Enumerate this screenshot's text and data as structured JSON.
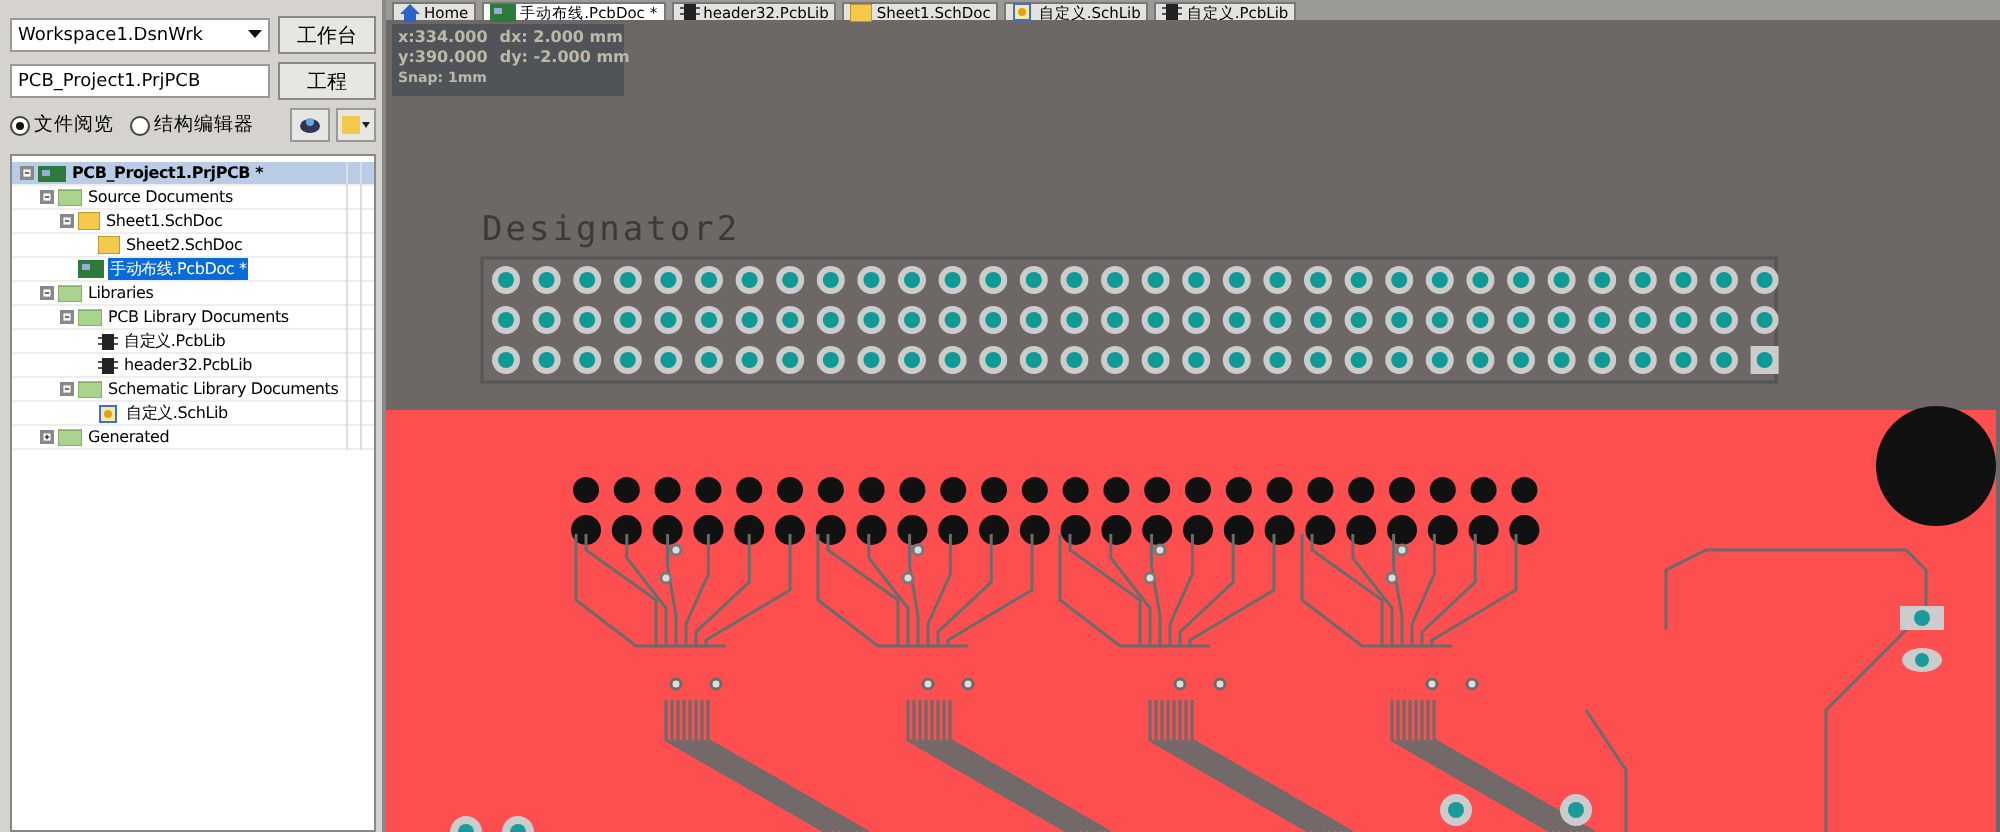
{
  "workspace": {
    "combo_value": "Workspace1.DsnWrk",
    "button": "工作台"
  },
  "project": {
    "field_value": "PCB_Project1.PrjPCB",
    "button": "工程"
  },
  "view_modes": [
    {
      "label": "文件阅览",
      "selected": true
    },
    {
      "label": "结构编辑器",
      "selected": false
    }
  ],
  "tree": [
    {
      "label": "PCB_Project1.PrjPCB *",
      "kind": "project",
      "expanded": true,
      "selected": false,
      "children": [
        {
          "label": "Source Documents",
          "kind": "folder",
          "expanded": true,
          "selected": false,
          "children": [
            {
              "label": "Sheet1.SchDoc",
              "kind": "schdoc",
              "expanded": true,
              "selected": false,
              "children": [
                {
                  "label": "Sheet2.SchDoc",
                  "kind": "schdoc",
                  "selected": false
                }
              ]
            },
            {
              "label": "手动布线.PcbDoc *",
              "kind": "pcbdoc",
              "selected": true
            }
          ]
        },
        {
          "label": "Libraries",
          "kind": "folder",
          "expanded": true,
          "selected": false,
          "children": [
            {
              "label": "PCB Library Documents",
              "kind": "folder",
              "expanded": true,
              "selected": false,
              "children": [
                {
                  "label": "自定义.PcbLib",
                  "kind": "pcblib",
                  "selected": false
                },
                {
                  "label": "header32.PcbLib",
                  "kind": "pcblib",
                  "selected": false
                }
              ]
            },
            {
              "label": "Schematic Library Documents",
              "kind": "folder",
              "expanded": true,
              "selected": false,
              "children": [
                {
                  "label": "自定义.SchLib",
                  "kind": "schlib",
                  "selected": false
                }
              ]
            }
          ]
        },
        {
          "label": "Generated",
          "kind": "folder",
          "expanded": false,
          "selected": false
        }
      ]
    }
  ],
  "doc_tabs": [
    {
      "label": "Home",
      "kind": "home",
      "selected": false
    },
    {
      "label": "手动布线.PcbDoc *",
      "kind": "pcbdoc",
      "selected": true
    },
    {
      "label": "header32.PcbLib",
      "kind": "pcblib",
      "selected": false
    },
    {
      "label": "Sheet1.SchDoc",
      "kind": "schdoc",
      "selected": false
    },
    {
      "label": "自定义.SchLib",
      "kind": "schlib",
      "selected": false
    },
    {
      "label": "自定义.PcbLib",
      "kind": "pcblib",
      "selected": false
    }
  ],
  "coords": {
    "x": "x:334.000",
    "dx": "dx:  2.000 mm",
    "y": "y:390.000",
    "dy": "dy: -2.000 mm",
    "snap": "Snap: 1mm"
  },
  "component": {
    "designator": "Designator2"
  }
}
